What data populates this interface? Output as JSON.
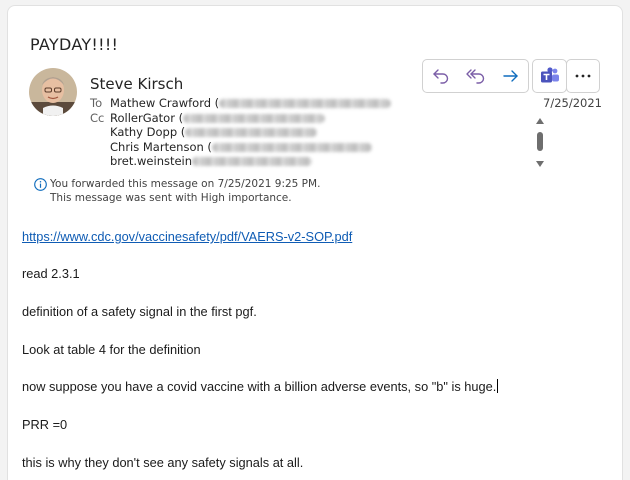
{
  "email": {
    "subject": "PAYDAY!!!!",
    "sender_name": "Steve Kirsch",
    "date": "7/25/2021",
    "to_label": "To",
    "cc_label": "Cc",
    "to": [
      {
        "name": "Mathew Crawford ("
      }
    ],
    "cc": [
      {
        "name": "RollerGator ("
      },
      {
        "name": "Kathy Dopp ("
      },
      {
        "name": "Chris Martenson ("
      },
      {
        "name": "bret.weinstein"
      }
    ],
    "info_lines": [
      "You forwarded this message on 7/25/2021 9:25 PM.",
      "This message was sent with High importance."
    ],
    "body": {
      "link": "https://www.cdc.gov/vaccinesafety/pdf/VAERS-v2-SOP.pdf",
      "paragraphs": [
        "read 2.3.1",
        "definition of a safety signal in the first pgf.",
        "Look at table 4 for the definition",
        "now suppose you have a covid vaccine with a billion adverse events, so \"b\" is huge.",
        "PRR =0",
        "this is why they don't see any safety signals at all."
      ]
    }
  },
  "icons": {
    "reply": "reply-icon",
    "reply_all": "reply-all-icon",
    "forward": "forward-icon",
    "teams": "teams-icon",
    "more": "more-icon",
    "info": "info-icon"
  },
  "colors": {
    "accent": "#7b5ea7",
    "teams": "#4b53bc",
    "link": "#0f5cb4"
  }
}
